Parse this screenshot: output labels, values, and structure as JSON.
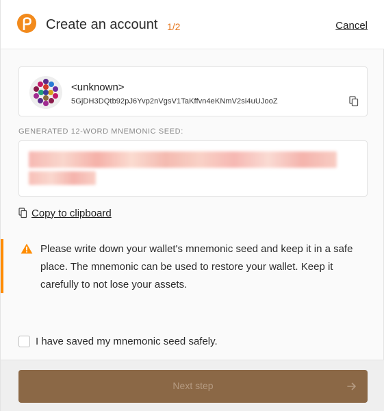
{
  "header": {
    "title": "Create an account",
    "step": "1/2",
    "cancel_label": "Cancel",
    "logo_icon": "polkadot-logo-icon",
    "accent_color": "#e5751b"
  },
  "account": {
    "name": "<unknown>",
    "address": "5GjDH3DQtb92pJ6Yvp2nVgsV1TaKffvn4eKNmV2si4uUJooZ",
    "avatar_icon": "identicon-icon",
    "copy_icon": "copy-icon"
  },
  "seed": {
    "label": "GENERATED 12-WORD MNEMONIC SEED:",
    "value_state": "blurred"
  },
  "copy_clipboard_label": "Copy to clipboard",
  "warning": {
    "icon": "warning-icon",
    "text": "Please write down your wallet's mnemonic seed and keep it in a safe place. The mnemonic can be used to restore your wallet. Keep it carefully to not lose your assets.",
    "color": "#ff8c00"
  },
  "confirm_checkbox": {
    "label": "I have saved my mnemonic seed safely.",
    "checked": false
  },
  "footer": {
    "next_label": "Next step",
    "next_disabled": true,
    "button_color": "#8b6846"
  }
}
